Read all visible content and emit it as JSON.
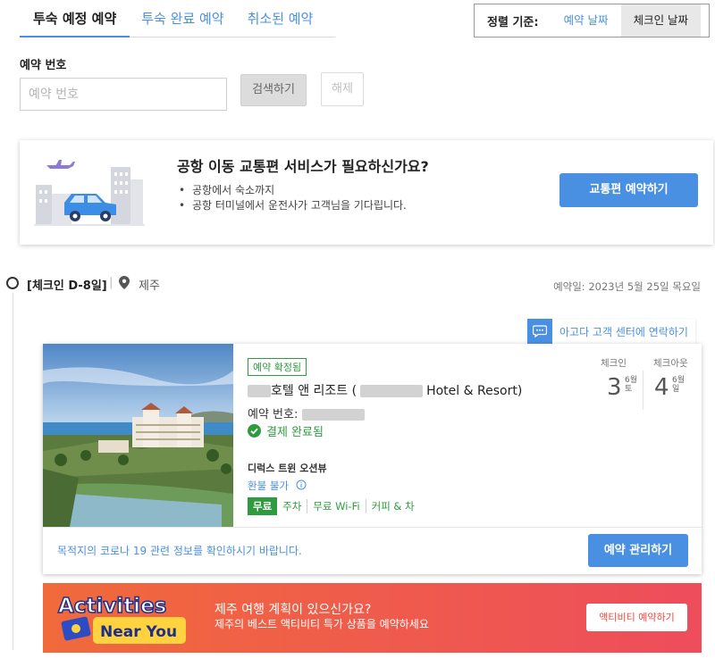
{
  "tabs": [
    {
      "label": "투숙 예정 예약",
      "active": true
    },
    {
      "label": "투숙 완료 예약",
      "active": false
    },
    {
      "label": "취소된 예약",
      "active": false
    }
  ],
  "sort": {
    "label": "정렬 기준:",
    "options": [
      {
        "label": "예약 날짜",
        "active": false
      },
      {
        "label": "체크인 날짜",
        "active": true
      }
    ]
  },
  "search": {
    "label": "예약 번호",
    "placeholder": "예약 번호",
    "search_button": "검색하기",
    "clear_button": "해제"
  },
  "transfer": {
    "title": "공항 이동 교통편 서비스가 필요하신가요?",
    "bullets": [
      "공항에서 숙소까지",
      "공항 터미널에서 운전사가 고객님을 기다립니다."
    ],
    "button": "교통편 예약하기"
  },
  "timeline": {
    "checkin": "[체크인 D-8일]",
    "separator": "|",
    "city": "제주",
    "booking_date": "예약일: 2023년 5월 25일 목요일"
  },
  "support": {
    "label": "아고다 고객 센터에 연락하기"
  },
  "booking": {
    "status_badge": "예약 확정됨",
    "hotel_name_ko": "호텔 앤 리조트 (",
    "hotel_name_en": "Hotel & Resort)",
    "reservation_label": "예약 번호:",
    "payment_status": "결제 완료됨",
    "room_type": "디럭스 트윈 오션뷰",
    "refund": "환불 불가",
    "amenities": {
      "free_badge": "무료",
      "items": [
        "주차",
        "무료 Wi-Fi",
        "커피 & 차"
      ]
    },
    "checkin_label": "체크인",
    "checkin_day": "3",
    "checkin_month": "6월",
    "checkin_weekday": "토",
    "checkout_label": "체크아웃",
    "checkout_day": "4",
    "checkout_month": "6월",
    "checkout_weekday": "일",
    "covid_notice": "목적지의 코로나 19 관련 정보를 확인하시기 바랍니다.",
    "manage_button": "예약 관리하기"
  },
  "activities": {
    "logo_line1": "Activities",
    "logo_line2": "Near You",
    "title": "제주 여행 계획이 있으신가요?",
    "subtitle": "제주의 베스트 액티비티 특가 상품을 예약하세요",
    "button": "액티비티 예약하기"
  },
  "colors": {
    "accent": "#4a90e2",
    "success": "#2e9b3e",
    "banner": "#ef5a4d"
  }
}
